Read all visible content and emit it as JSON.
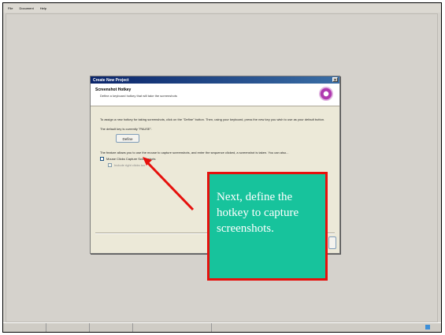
{
  "app": {
    "menu": [
      "File",
      "Document",
      "Help"
    ]
  },
  "dialog": {
    "title": "Create New Project",
    "close_label": "×",
    "header_title": "Screenshot Hotkey",
    "header_subtitle": "Define a keyboard hotkey that will take the screenshots",
    "intro_text": "To assign a new hotkey for taking screenshots, click on the \"Define\" button. Then, using your keyboard, press the new key you wish to use as your default button.",
    "default_key_text": "The default key is currently \"PAUSE\".",
    "define_button": "Define",
    "feature_text": "The feature allows you to use the mouse to capture screenshots, and enter the sequence clicked, a screenshot is taken. You can also...",
    "checkbox_mouse_label": "Mouse Clicks Capture Screenshots",
    "checkbox_sub_label": "Include right clicks too"
  },
  "callout": {
    "text": "Next, define the hotkey to capture screenshots."
  },
  "colors": {
    "callout_fill": "#17c39c",
    "callout_border": "#e6100c",
    "arrow": "#e6100c"
  }
}
